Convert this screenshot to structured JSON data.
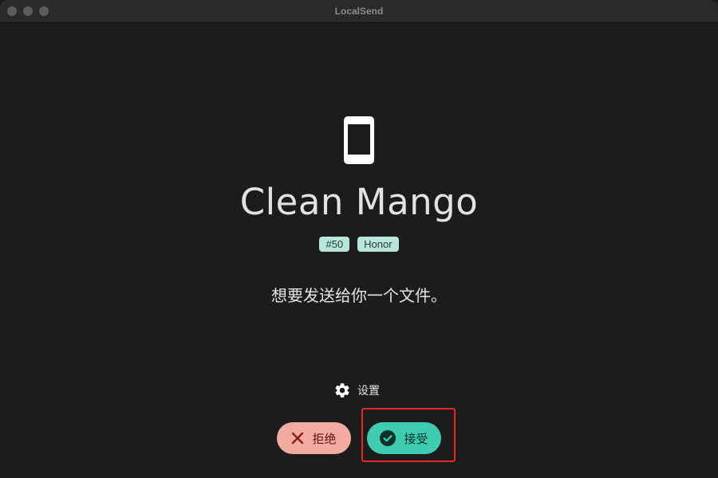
{
  "window": {
    "title": "LocalSend"
  },
  "device": {
    "icon": "smartphone-icon",
    "name": "Clean Mango",
    "badges": [
      "#50",
      "Honor"
    ]
  },
  "message": "想要发送给你一个文件。",
  "settings": {
    "icon": "gear-icon",
    "label": "设置"
  },
  "actions": {
    "reject": {
      "icon": "close-icon",
      "label": "拒绝"
    },
    "accept": {
      "icon": "check-circle-icon",
      "label": "接受"
    }
  },
  "colors": {
    "background": "#1c1c1c",
    "titlebar": "#2b2a2a",
    "badge_bg": "#b8e6da",
    "reject_bg": "#f2aba1",
    "accept_bg": "#3fcdb2",
    "highlight": "#e8291f"
  }
}
